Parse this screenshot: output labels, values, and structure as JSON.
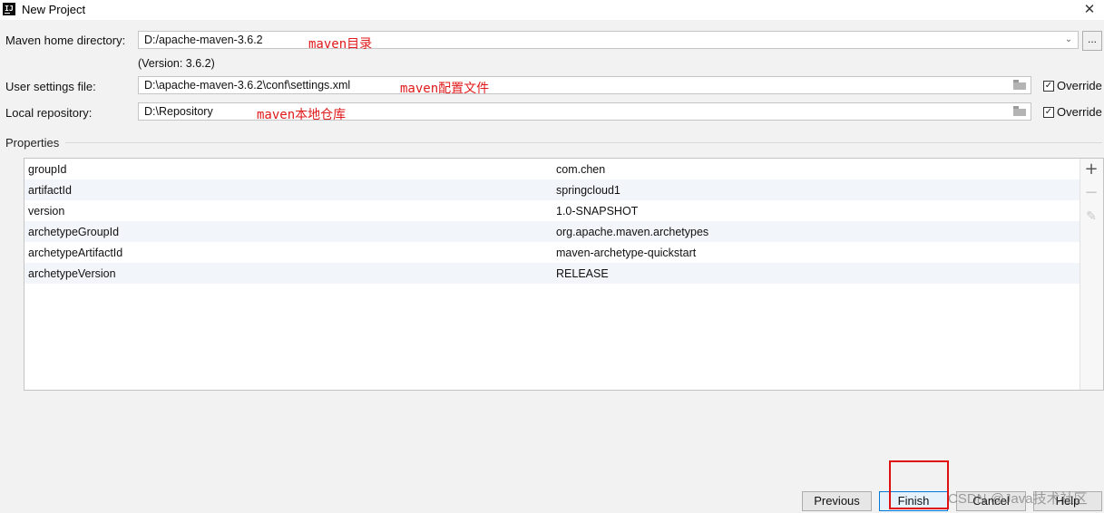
{
  "window": {
    "title": "New Project",
    "app_icon": "intellij-icon",
    "close_symbol": "✕"
  },
  "maven_home": {
    "label": "Maven home directory:",
    "value": "D:/apache-maven-3.6.2",
    "annotation": "maven目录",
    "version_text": "(Version: 3.6.2)",
    "browse_label": "..."
  },
  "user_settings": {
    "label": "User settings file:",
    "value": "D:\\apache-maven-3.6.2\\conf\\settings.xml",
    "annotation": "maven配置文件",
    "override_label": "Override",
    "override_checked": true
  },
  "local_repository": {
    "label": "Local repository:",
    "value": "D:\\Repository",
    "annotation": "maven本地仓库",
    "override_label": "Override",
    "override_checked": true
  },
  "properties": {
    "title": "Properties",
    "rows": [
      {
        "key": "groupId",
        "value": "com.chen"
      },
      {
        "key": "artifactId",
        "value": "springcloud1"
      },
      {
        "key": "version",
        "value": "1.0-SNAPSHOT"
      },
      {
        "key": "archetypeGroupId",
        "value": "org.apache.maven.archetypes"
      },
      {
        "key": "archetypeArtifactId",
        "value": "maven-archetype-quickstart"
      },
      {
        "key": "archetypeVersion",
        "value": "RELEASE"
      }
    ],
    "toolbar": {
      "add": "+",
      "remove": "−",
      "edit": "✎"
    }
  },
  "buttons": {
    "previous": "Previous",
    "finish": "Finish",
    "cancel": "Cancel",
    "help": "Help"
  },
  "watermark": "CSDN @Java技术社区",
  "colors": {
    "annotation_red": "#e0191a",
    "primary_border": "#0078d7",
    "highlight": "#e01010"
  }
}
